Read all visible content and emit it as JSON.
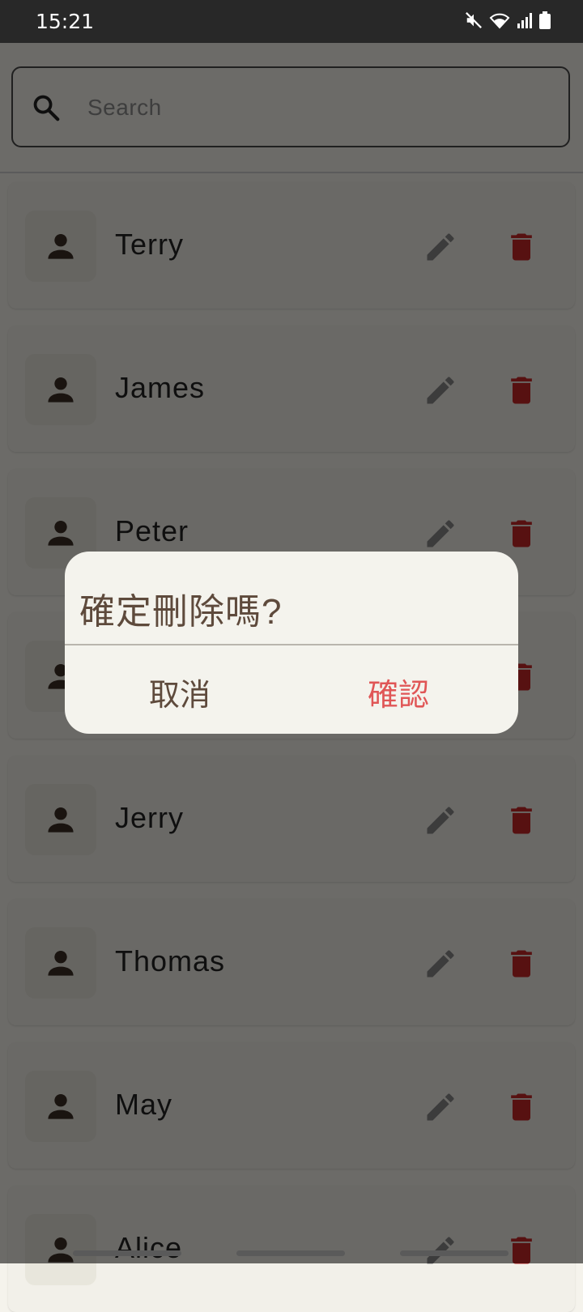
{
  "status_bar": {
    "time": "15:21"
  },
  "search": {
    "placeholder": "Search",
    "value": ""
  },
  "contacts": [
    {
      "name": "Terry"
    },
    {
      "name": "James"
    },
    {
      "name": "Peter"
    },
    {
      "name": ""
    },
    {
      "name": "Jerry"
    },
    {
      "name": "Thomas"
    },
    {
      "name": "May"
    },
    {
      "name": "Alice"
    }
  ],
  "dialog": {
    "title": "確定刪除嗎?",
    "cancel_label": "取消",
    "confirm_label": "確認"
  },
  "colors": {
    "delete_icon": "#c62828",
    "confirm_text": "#e05656",
    "dialog_text": "#5e4a3c"
  },
  "icons": {
    "search": "search-icon",
    "avatar": "person-icon",
    "edit": "pencil-icon",
    "delete": "trash-icon"
  }
}
